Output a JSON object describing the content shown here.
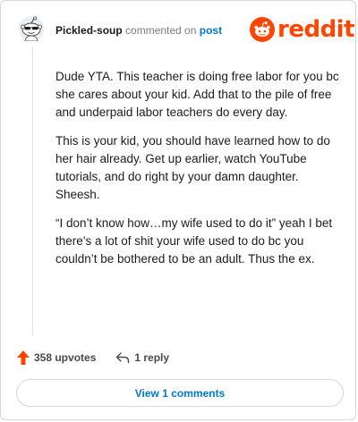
{
  "comment": {
    "username": "Pickled-soup",
    "action_text": "commented on",
    "link_text": "post",
    "paragraphs": [
      "Dude YTA. This teacher is doing free labor for you bc she cares about your kid. Add that to the pile of free and underpaid labor teachers do every day.",
      "This is your kid, you should have learned how to do her hair already. Get up earlier, watch YouTube tutorials, and do right by your damn daughter. Sheesh.",
      "“I don’t know how…my wife used to do it” yeah I bet there’s a lot of shit your wife used to do bc you couldn’t be bothered to be an adult. Thus the ex."
    ]
  },
  "brand": {
    "logo_text": "reddit",
    "color": "#ff4500"
  },
  "actions": {
    "upvotes_label": "358 upvotes",
    "reply_label": "1 reply",
    "upvote_icon": "upvote-arrow-icon",
    "reply_icon": "reply-arrow-icon"
  },
  "footer": {
    "view_comments_label": "View 1 comments"
  },
  "colors": {
    "accent_blue": "#0079d3",
    "upvote": "#ff4500",
    "muted": "#7c7c7c"
  }
}
